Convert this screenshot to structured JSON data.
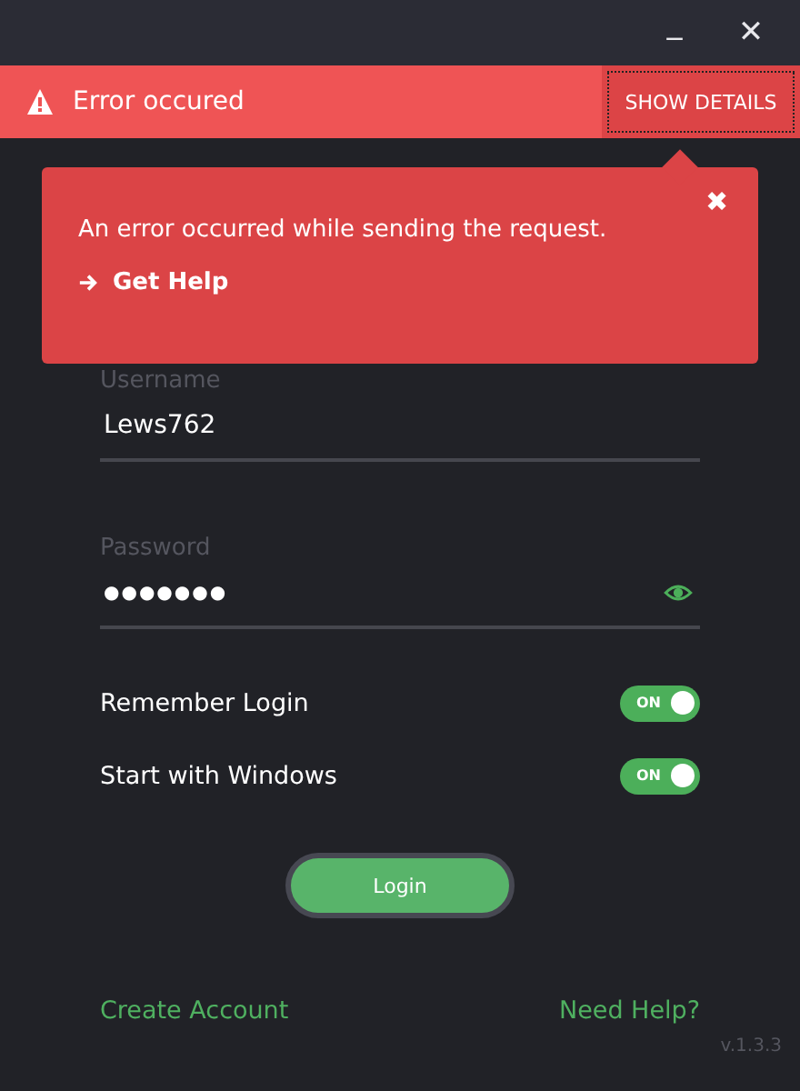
{
  "window": {
    "minimize": "_",
    "close": "✕"
  },
  "error_bar": {
    "message": "Error occured",
    "button": "SHOW DETAILS"
  },
  "error_popup": {
    "close": "✖",
    "message": "An error occurred while sending the request.",
    "link": "Get Help"
  },
  "fields": [
    {
      "kind": "text",
      "label": "Username",
      "value": "Lews762"
    },
    {
      "kind": "password",
      "label": "Password",
      "value": "●●●●●●●"
    }
  ],
  "toggles": [
    {
      "label": "Remember Login",
      "on": true,
      "text": "ON"
    },
    {
      "label": "Start with Windows",
      "on": true,
      "text": "ON"
    }
  ],
  "login_button": "Login",
  "links": [
    "Create Account",
    "Need Help?"
  ],
  "version": "v.1.3.3"
}
